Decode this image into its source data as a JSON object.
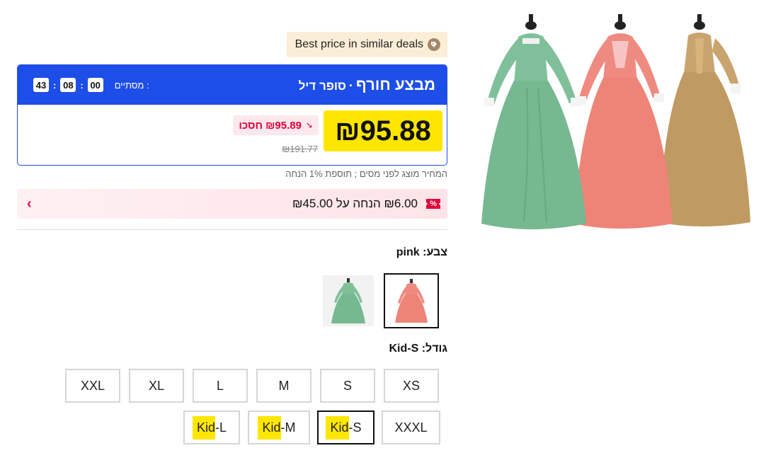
{
  "best_price": {
    "label": "Best price in similar deals",
    "icon": "tag-icon"
  },
  "deal": {
    "title": "מבצע חורף",
    "separator": "·",
    "subtitle": "סופר דיל",
    "ends_label": "מסתיים :",
    "timer": {
      "hours": "00",
      "minutes": "08",
      "seconds": "43"
    }
  },
  "price": {
    "current": "₪95.88",
    "save_text": "₪95.89 חסכו",
    "original": "₪191.77"
  },
  "tax_note": "המחיר מוצג לפני מסים ; תוספת 1% הנחה",
  "coupon": {
    "badge": "%",
    "text": "₪6.00 הנחה על ₪45.00"
  },
  "color": {
    "label": "צבע:",
    "value": "pink",
    "options": [
      "pink",
      "green"
    ]
  },
  "size": {
    "label": "גודל:",
    "value": "Kid-S",
    "row1": [
      "XXL",
      "XL",
      "L",
      "M",
      "S",
      "XS"
    ],
    "row2_kid_prefix": "Kid",
    "row2": [
      {
        "prefix": "Kid",
        "suffix": "-L"
      },
      {
        "prefix": "Kid",
        "suffix": "-M"
      },
      {
        "prefix": "Kid",
        "suffix": "-S"
      },
      {
        "prefix": "",
        "suffix": "XXXL"
      }
    ]
  },
  "colors": {
    "brand_blue": "#1e4ee8",
    "highlight_yellow": "#ffe600",
    "sale_red": "#e4003a",
    "dress_green": "#7fc09a",
    "dress_pink": "#ef8a80",
    "dress_gold": "#c9a46e"
  }
}
